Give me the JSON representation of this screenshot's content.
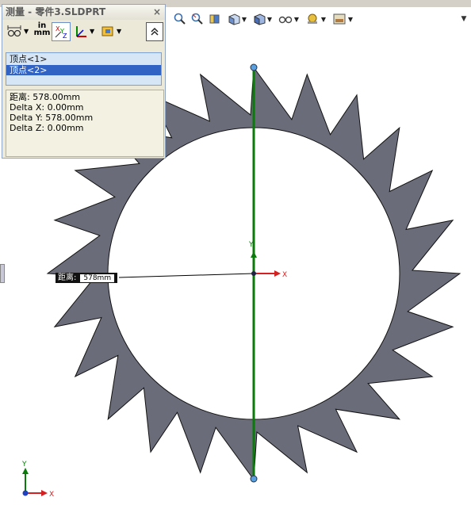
{
  "panel": {
    "title": "测量 - 零件3.SLDPRT",
    "close_glyph": "×",
    "units_label_top": "in",
    "units_label_bottom": "mm",
    "xyz_label": "XYZ",
    "selections": [
      "顶点<1>",
      "顶点<2>"
    ],
    "results": [
      "距离: 578.00mm",
      "Delta X: 0.00mm",
      "Delta Y: 578.00mm",
      "Delta Z: 0.00mm"
    ]
  },
  "viewport": {
    "distance_label": "距离:",
    "distance_value": "578mm",
    "origin_x": "X",
    "origin_y": "Y",
    "triad_x": "X",
    "triad_y": "Y"
  },
  "toolbar": {
    "icons": [
      "zoom-icon",
      "zoom-area-icon",
      "section-view-icon",
      "view-orientation-icon",
      "display-style-icon",
      "hide-show-icon",
      "appearance-icon",
      "scene-icon"
    ]
  },
  "colors": {
    "gear_fill": "#6a6c79",
    "axis_green": "#0a7a0a",
    "axis_red": "#d42020",
    "selection_blue": "#3163c5"
  }
}
